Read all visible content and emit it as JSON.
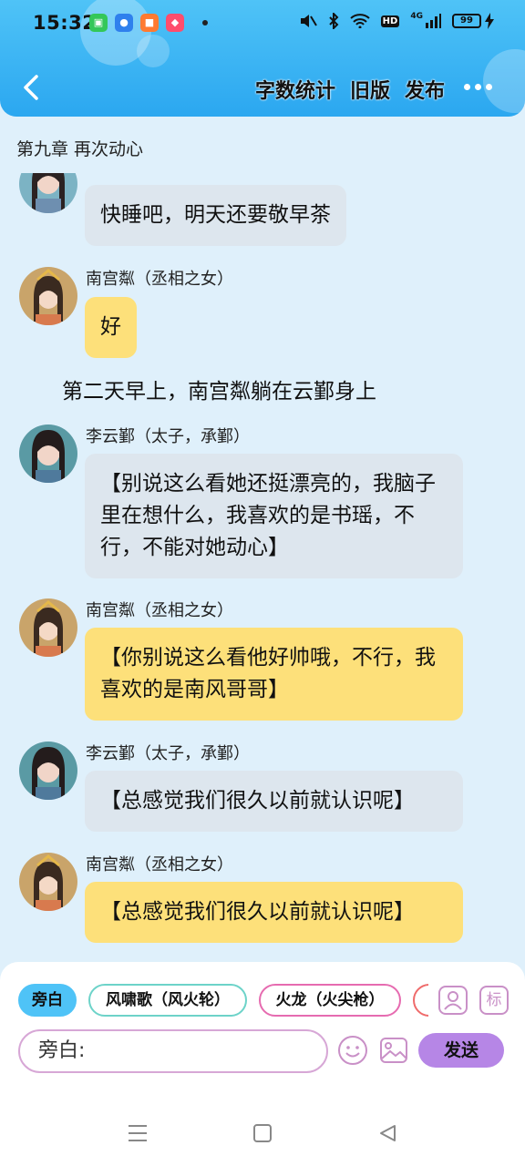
{
  "status_bar": {
    "time": "15:32",
    "battery": "99",
    "network": "4G",
    "hd": "HD"
  },
  "header": {
    "actions": [
      "字数统计",
      "旧版",
      "发布"
    ]
  },
  "chapter": {
    "title": "第九章  再次动心"
  },
  "messages": [
    {
      "type": "bubble",
      "style": "gray",
      "text": "快睡吧，明天还要敬早茶"
    },
    {
      "type": "bubble",
      "style": "yellow",
      "speaker": "南宫粼（丞相之女）",
      "text": "好"
    },
    {
      "type": "narration",
      "text": "第二天早上，南宫粼躺在云鄞身上"
    },
    {
      "type": "bubble",
      "style": "gray",
      "speaker": "李云鄞（太子，承鄞）",
      "text": "【别说这么看她还挺漂亮的，我脑子里在想什么，我喜欢的是书瑶，不行，不能对她动心】"
    },
    {
      "type": "bubble",
      "style": "yellow",
      "speaker": "南宫粼（丞相之女）",
      "text": "【你别说这么看他好帅哦，不行，我喜欢的是南风哥哥】"
    },
    {
      "type": "bubble",
      "style": "gray",
      "speaker": "李云鄞（太子，承鄞）",
      "text": "【总感觉我们很久以前就认识呢】"
    },
    {
      "type": "bubble",
      "style": "yellow",
      "speaker": "南宫粼（丞相之女）",
      "text": "【总感觉我们很久以前就认识呢】"
    }
  ],
  "roles": [
    {
      "label": "旁白",
      "active": true
    },
    {
      "label": "风啸歌（风火轮）",
      "border": "#6dd3c9"
    },
    {
      "label": "火龙（火尖枪）",
      "border": "#e66bb0"
    }
  ],
  "tools": {
    "role_icon": "person-icon",
    "tag_label": "标"
  },
  "composer": {
    "placeholder": "旁白:",
    "send_label": "发送"
  },
  "colors": {
    "header": "#2ba7f0",
    "gray_bubble": "#dde6ee",
    "yellow_bubble": "#fde07a",
    "send": "#b686e6"
  }
}
